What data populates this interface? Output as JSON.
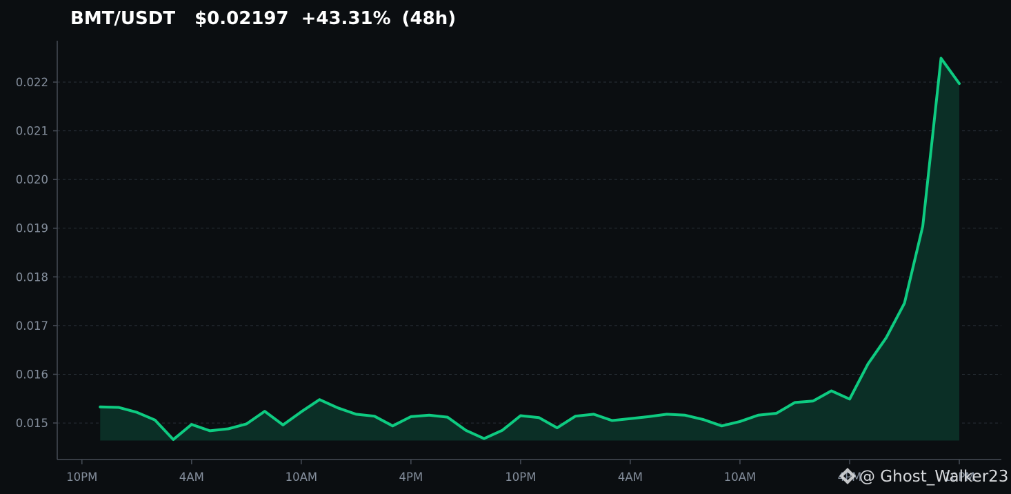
{
  "header": {
    "pair": "BMT/USDT",
    "price": "$0.02197",
    "change": "+43.31%",
    "period": "(48h)"
  },
  "watermark": {
    "handle": "@ Ghost_Walker23",
    "icon": "binance-logo-icon"
  },
  "colors": {
    "background": "#0b0e11",
    "line": "#0ecb81",
    "area": "#0b2f26",
    "grid": "#2b3139",
    "tick_text": "#848e9c",
    "title": "#ffffff"
  },
  "chart_data": {
    "type": "area",
    "title": "BMT/USDT   $0.02197  +43.31%  (48h)",
    "xlabel": "",
    "ylabel": "",
    "x_ticks": [
      "10PM",
      "4AM",
      "10AM",
      "4PM",
      "10PM",
      "4AM",
      "10AM",
      "4PM",
      "10PM"
    ],
    "x_tick_hours": [
      0,
      6,
      12,
      18,
      24,
      30,
      36,
      42,
      48
    ],
    "xlim": [
      -1.35,
      50.3
    ],
    "y_ticks": [
      0.015,
      0.016,
      0.017,
      0.018,
      0.019,
      0.02,
      0.021,
      0.022
    ],
    "y_tick_labels": [
      "0.015",
      "0.016",
      "0.017",
      "0.018",
      "0.019",
      "0.020",
      "0.021",
      "0.022"
    ],
    "ylim": [
      0.01425,
      0.02285
    ],
    "area_baseline": 0.01464,
    "grid": true,
    "legend": "none",
    "series": [
      {
        "x": [
          1,
          2,
          3,
          4,
          5,
          6,
          7,
          8,
          9,
          10,
          11,
          12,
          13,
          14,
          15,
          16,
          17,
          18,
          19,
          20,
          21,
          22,
          23,
          24,
          25,
          26,
          27,
          28,
          29,
          30,
          31,
          32,
          33,
          34,
          35,
          36,
          37,
          38,
          39,
          40,
          41,
          42,
          43,
          44,
          45,
          46,
          47,
          48
        ],
        "values": [
          0.01533,
          0.01532,
          0.01522,
          0.01506,
          0.01466,
          0.01497,
          0.01484,
          0.01488,
          0.01498,
          0.01524,
          0.01496,
          0.01523,
          0.01548,
          0.01531,
          0.01518,
          0.01514,
          0.01494,
          0.01513,
          0.01516,
          0.01512,
          0.01485,
          0.01468,
          0.01485,
          0.01515,
          0.01511,
          0.0149,
          0.01514,
          0.01518,
          0.01505,
          0.01509,
          0.01513,
          0.01518,
          0.01516,
          0.01507,
          0.01494,
          0.01503,
          0.01516,
          0.0152,
          0.01542,
          0.01545,
          0.01566,
          0.01549,
          0.01621,
          0.01675,
          0.01746,
          0.01904,
          0.02249,
          0.02197
        ]
      }
    ]
  }
}
